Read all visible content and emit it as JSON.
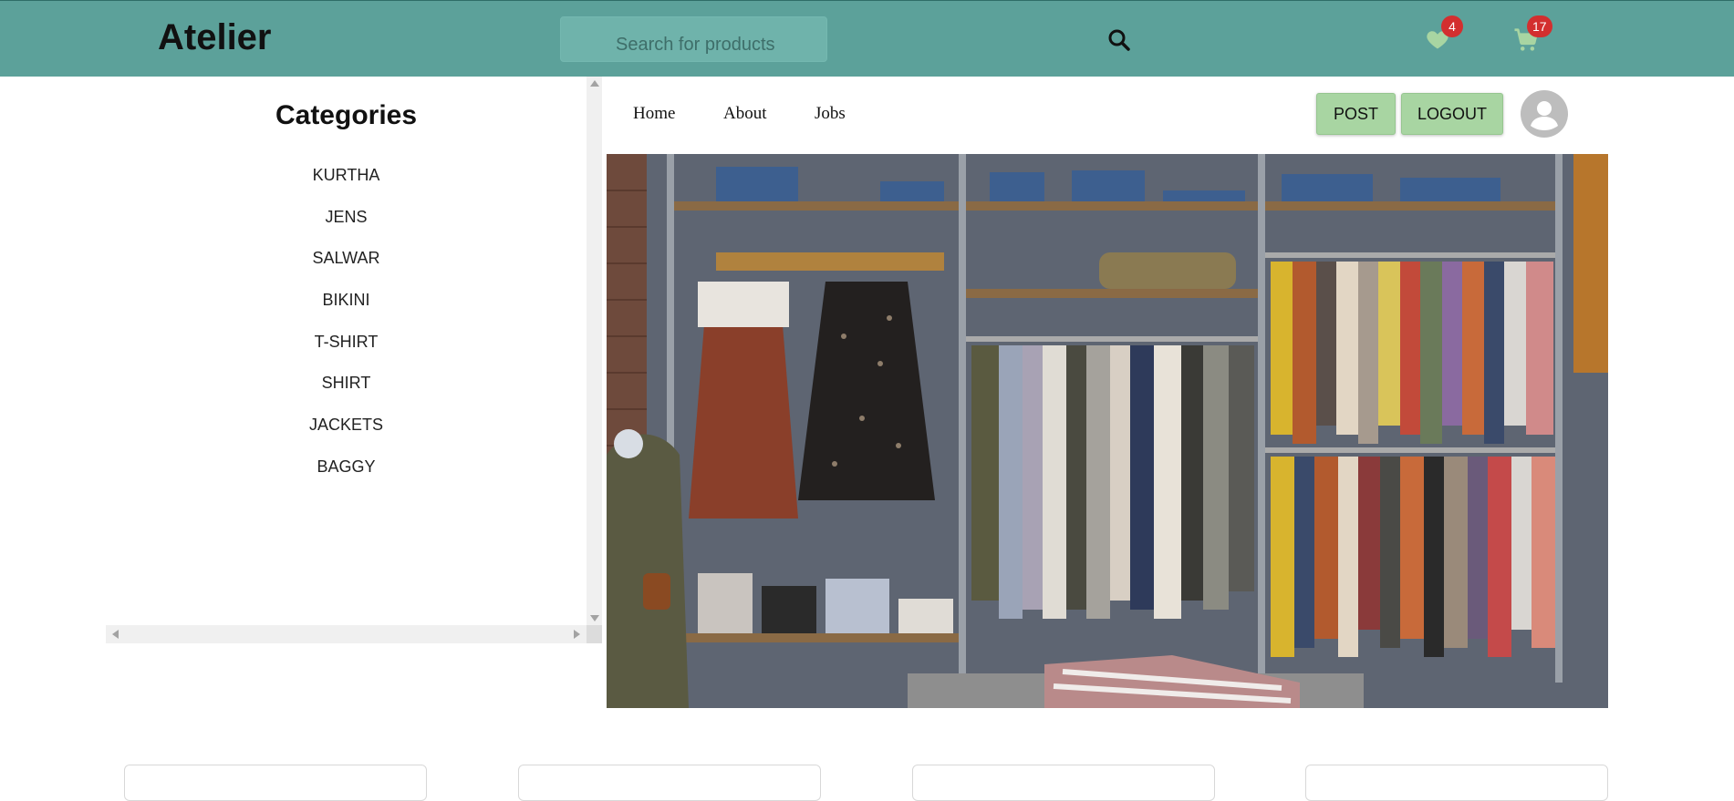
{
  "header": {
    "brand": "Atelier",
    "search_placeholder": "Search for products",
    "wishlist_count": "4",
    "cart_count": "17",
    "bg_color": "#5ca19a",
    "badge_color": "#d32f2f",
    "icons": [
      "search-icon",
      "heart-icon",
      "cart-icon"
    ]
  },
  "sidebar": {
    "title": "Categories",
    "items": [
      "KURTHA",
      "JENS",
      "SALWAR",
      "BIKINI",
      "T-SHIRT",
      "SHIRT",
      "JACKETS",
      "BAGGY"
    ]
  },
  "nav": {
    "links": [
      "Home",
      "About",
      "Jobs"
    ],
    "post_label": "POST",
    "logout_label": "LOGOUT",
    "button_color": "#a8d5a2"
  },
  "hero": {
    "alt": "Clothing store interior with racks of garments"
  },
  "products": {
    "card_count": 4
  }
}
